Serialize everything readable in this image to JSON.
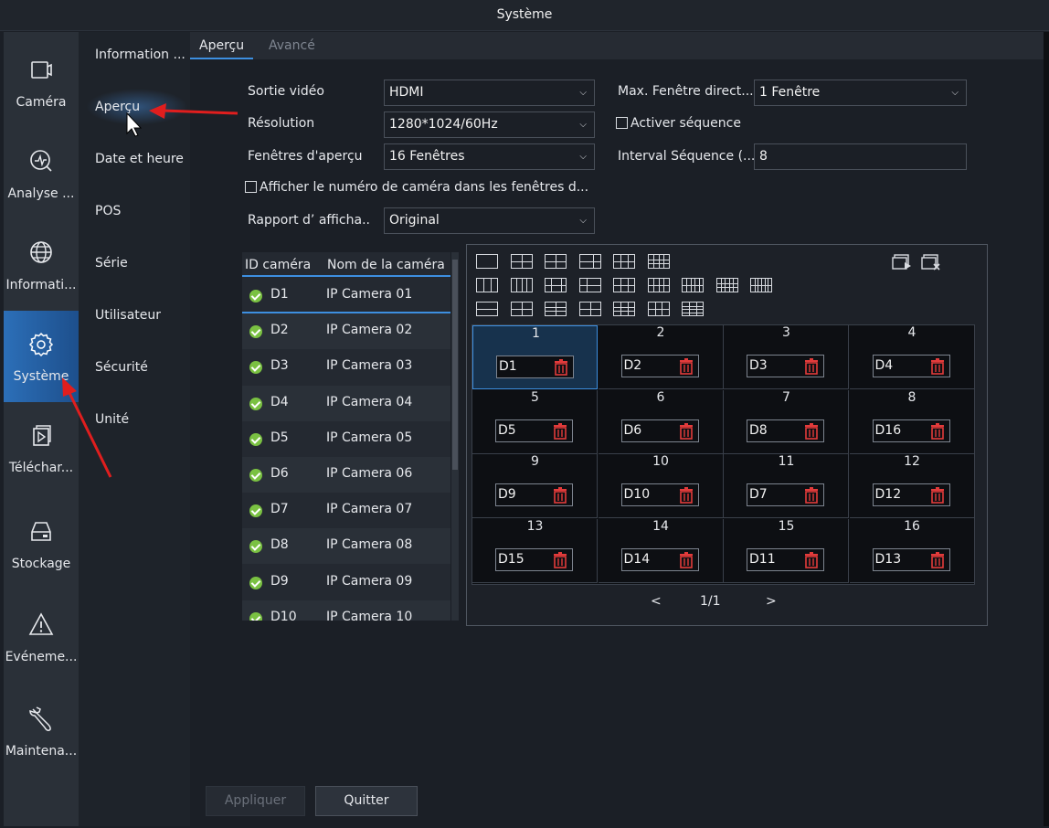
{
  "window": {
    "title": "Système"
  },
  "leftnav": {
    "items": [
      {
        "label": "Caméra",
        "icon": "camera-icon"
      },
      {
        "label": "Analyse ...",
        "icon": "analytics-icon"
      },
      {
        "label": "Informati...",
        "icon": "globe-icon"
      },
      {
        "label": "Système",
        "icon": "gear-icon",
        "active": true
      },
      {
        "label": "Téléchar...",
        "icon": "download-icon"
      },
      {
        "label": "Stockage",
        "icon": "storage-icon"
      },
      {
        "label": "Evéneme...",
        "icon": "warning-icon"
      },
      {
        "label": "Maintena...",
        "icon": "wrench-icon"
      }
    ]
  },
  "subnav": {
    "items": [
      {
        "label": "Information ..."
      },
      {
        "label": "Aperçu",
        "active": true
      },
      {
        "label": "Date et heure"
      },
      {
        "label": "POS"
      },
      {
        "label": "Série"
      },
      {
        "label": "Utilisateur"
      },
      {
        "label": "Sécurité"
      },
      {
        "label": "Unité"
      }
    ]
  },
  "tabs": [
    {
      "label": "Aperçu",
      "active": true
    },
    {
      "label": "Avancé",
      "active": false
    }
  ],
  "form": {
    "video_output": {
      "label": "Sortie vidéo",
      "value": "HDMI"
    },
    "resolution": {
      "label": "Résolution",
      "value": "1280*1024/60Hz"
    },
    "preview_windows": {
      "label": "Fenêtres d'aperçu",
      "value": "16 Fenêtres"
    },
    "max_window": {
      "label": "Max. Fenêtre direct...",
      "value": "1 Fenêtre"
    },
    "enable_sequence": {
      "label": "Activer séquence",
      "checked": false
    },
    "sequence_interval": {
      "label": "Interval Séquence (...",
      "value": "8"
    },
    "show_camera_number": {
      "label": "Afficher le numéro de caméra dans les fenêtres d...",
      "checked": false
    },
    "aspect_ratio": {
      "label": "Rapport d’ afficha..",
      "value": "Original"
    }
  },
  "camera_table": {
    "headers": [
      "ID caméra",
      "Nom de la caméra"
    ],
    "rows": [
      {
        "id": "D1",
        "name": "IP Camera 01",
        "status": "online"
      },
      {
        "id": "D2",
        "name": "IP Camera 02",
        "status": "online"
      },
      {
        "id": "D3",
        "name": "IP Camera 03",
        "status": "online"
      },
      {
        "id": "D4",
        "name": "IP Camera 04",
        "status": "online"
      },
      {
        "id": "D5",
        "name": "IP Camera 05",
        "status": "online"
      },
      {
        "id": "D6",
        "name": "IP Camera 06",
        "status": "online"
      },
      {
        "id": "D7",
        "name": "IP Camera 07",
        "status": "online"
      },
      {
        "id": "D8",
        "name": "IP Camera 08",
        "status": "online"
      },
      {
        "id": "D9",
        "name": "IP Camera 09",
        "status": "online"
      },
      {
        "id": "D10",
        "name": "IP Camera 10",
        "status": "online"
      }
    ]
  },
  "preview_grid": {
    "cells": [
      {
        "num": "1",
        "channel": "D1"
      },
      {
        "num": "2",
        "channel": "D2"
      },
      {
        "num": "3",
        "channel": "D3"
      },
      {
        "num": "4",
        "channel": "D4"
      },
      {
        "num": "5",
        "channel": "D5"
      },
      {
        "num": "6",
        "channel": "D6"
      },
      {
        "num": "7",
        "channel": "D8"
      },
      {
        "num": "8",
        "channel": "D16"
      },
      {
        "num": "9",
        "channel": "D9"
      },
      {
        "num": "10",
        "channel": "D10"
      },
      {
        "num": "11",
        "channel": "D7"
      },
      {
        "num": "12",
        "channel": "D12"
      },
      {
        "num": "13",
        "channel": "D15"
      },
      {
        "num": "14",
        "channel": "D14"
      },
      {
        "num": "15",
        "channel": "D11"
      },
      {
        "num": "16",
        "channel": "D13"
      }
    ],
    "pager": {
      "prev": "<",
      "page": "1/1",
      "next": ">"
    }
  },
  "buttons": {
    "apply": "Appliquer",
    "quit": "Quitter"
  },
  "colors": {
    "accent": "#3d8fe0",
    "online": "#7ac142",
    "delete": "#e23b3b",
    "annotation_arrow": "#e01e1e"
  }
}
